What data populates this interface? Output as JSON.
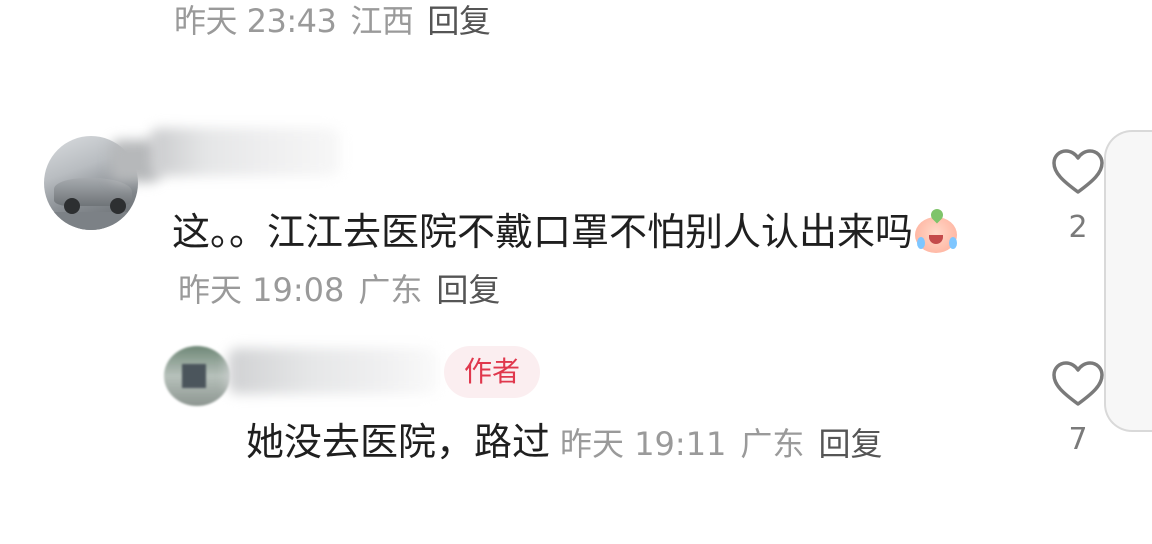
{
  "top_comment_meta": {
    "time": "昨天 23:43",
    "location": "江西",
    "reply_label": "回复"
  },
  "comment1": {
    "text": "这。。江江去医院不戴口罩不怕别人认出来吗",
    "emoji": "crying-face-emoji",
    "time": "昨天 19:08",
    "location": "广东",
    "reply_label": "回复",
    "like_count": "2"
  },
  "reply1": {
    "badge": "作者",
    "text": "她没去医院，路过",
    "time": "昨天 19:11",
    "location": "广东",
    "reply_label": "回复",
    "like_count": "7"
  },
  "colors": {
    "meta_gray": "#9a9a9a",
    "text_dark": "#1f1f1f",
    "author_badge_text": "#e0384d",
    "author_badge_bg": "#fbeef0"
  }
}
